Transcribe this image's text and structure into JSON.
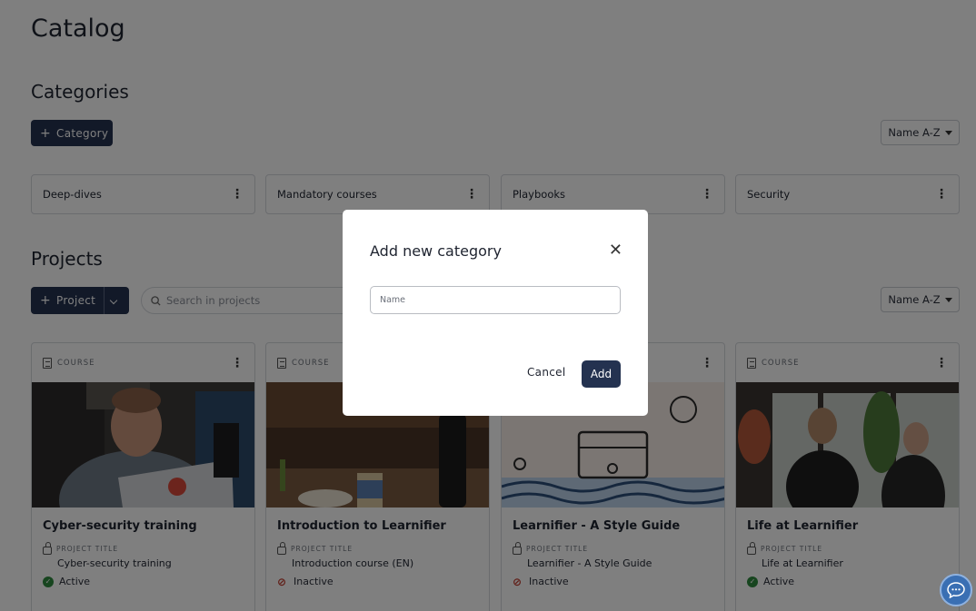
{
  "page": {
    "title": "Catalog"
  },
  "categories": {
    "heading": "Categories",
    "add_label": "Category",
    "sort_label": "Name A-Z",
    "items": [
      {
        "label": "Deep-dives"
      },
      {
        "label": "Mandatory courses"
      },
      {
        "label": "Playbooks"
      },
      {
        "label": "Security"
      }
    ]
  },
  "projects": {
    "heading": "Projects",
    "add_label": "Project",
    "search_placeholder": "Search in projects",
    "sort_label": "Name A-Z",
    "type_label": "COURSE",
    "project_title_label": "PROJECT TITLE",
    "items": [
      {
        "name": "Cyber-security training",
        "project_title": "Cyber-security training",
        "status": "Active"
      },
      {
        "name": "Introduction to Learnifier",
        "project_title": "Introduction course (EN)",
        "status": "Inactive"
      },
      {
        "name": "Learnifier - A Style Guide",
        "project_title": "Learnifier - A Style Guide",
        "status": "Inactive"
      },
      {
        "name": "Life at Learnifier",
        "project_title": "Life at Learnifier",
        "status": "Active"
      }
    ]
  },
  "modal": {
    "title": "Add new category",
    "name_placeholder": "Name",
    "cancel_label": "Cancel",
    "add_label": "Add"
  },
  "colors": {
    "primary": "#243250",
    "active": "#2e8b3e",
    "inactive": "#c0392b",
    "chat": "#3a6fb3"
  }
}
